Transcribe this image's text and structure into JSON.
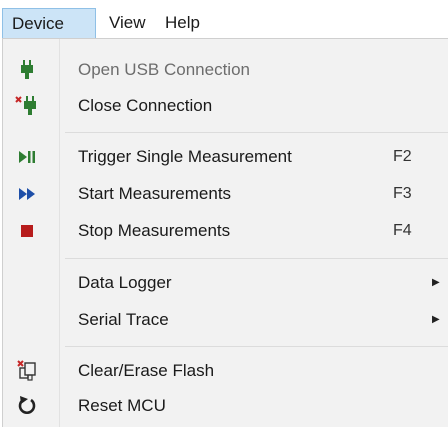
{
  "menubar": {
    "items": [
      {
        "label": "Device"
      },
      {
        "label": "View"
      },
      {
        "label": "Help"
      }
    ]
  },
  "menu": {
    "items": [
      {
        "label": "Open USB Connection",
        "icon": "usb-plug-icon",
        "enabled": false
      },
      {
        "label": "Close Connection",
        "icon": "usb-disconnect-icon"
      },
      {
        "label": "Trigger Single Measurement",
        "icon": "play-pause-icon",
        "shortcut": "F2"
      },
      {
        "label": "Start Measurements",
        "icon": "fast-forward-icon",
        "shortcut": "F3"
      },
      {
        "label": "Stop Measurements",
        "icon": "stop-icon",
        "shortcut": "F4"
      },
      {
        "label": "Data Logger",
        "submenu": true
      },
      {
        "label": "Serial Trace",
        "submenu": true
      },
      {
        "label": "Clear/Erase Flash",
        "icon": "erase-flash-icon"
      },
      {
        "label": "Reset MCU",
        "icon": "reset-icon"
      }
    ]
  },
  "colors": {
    "icon_green": "#2e7d32",
    "icon_red": "#c62828",
    "icon_blue": "#1e4fa8",
    "stop_red": "#b71c1c",
    "active_menu_bg": "#cce4f7"
  }
}
